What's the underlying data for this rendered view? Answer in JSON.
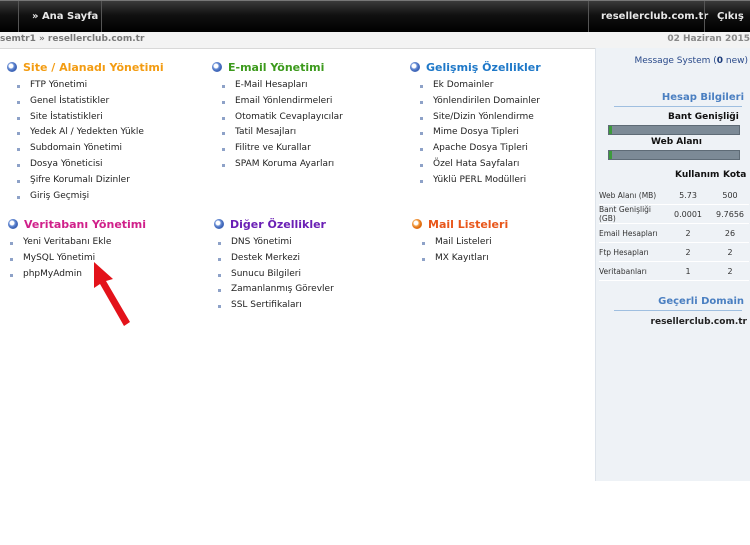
{
  "topbar": {
    "home_label": "» Ana Sayfa",
    "domain_label": "resellerclub.com.tr",
    "logout_label": "Çıkış"
  },
  "breadcrumb": {
    "text": "semtr1 » resellerclub.com.tr",
    "date": "02 Haziran 2015"
  },
  "sections": {
    "site": {
      "title": "Site / Alanadı Yönetimi",
      "color": "#f39c12",
      "items": [
        "FTP Yönetimi",
        "Genel İstatistikler",
        "Site İstatistikleri",
        "Yedek Al / Yedekten Yükle",
        "Subdomain Yönetimi",
        "Dosya Yöneticisi",
        "Şifre Korumalı Dizinler",
        "Giriş Geçmişi"
      ]
    },
    "email": {
      "title": "E-mail Yönetimi",
      "color": "#3c9a1c",
      "items": [
        "E-Mail Hesapları",
        "Email Yönlendirmeleri",
        "Otomatik Cevaplayıcılar",
        "Tatil Mesajları",
        "Filitre ve Kurallar",
        "SPAM Koruma Ayarları"
      ]
    },
    "advanced": {
      "title": "Gelişmiş Özellikler",
      "color": "#1e78c8",
      "items": [
        "Ek Domainler",
        "Yönlendirilen Domainler",
        "Site/Dizin Yönlendirme",
        "Mime Dosya Tipleri",
        "Apache Dosya Tipleri",
        "Özel Hata Sayfaları",
        "Yüklü PERL Modülleri"
      ]
    },
    "database": {
      "title": "Veritabanı Yönetimi",
      "color": "#d0208a",
      "items": [
        "Yeni Veritabanı Ekle",
        "MySQL Yönetimi",
        "phpMyAdmin"
      ]
    },
    "other": {
      "title": "Diğer Özellikler",
      "color": "#6a1fb5",
      "items": [
        "DNS Yönetimi",
        "Destek Merkezi",
        "Sunucu Bilgileri",
        "Zamanlanmış Görevler",
        "SSL Sertifikaları"
      ]
    },
    "mail_lists": {
      "title": "Mail Listeleri",
      "color": "#e8561a",
      "items": [
        "Mail Listeleri",
        "MX Kayıtları"
      ]
    }
  },
  "right_panel": {
    "message_prefix": "Message System (",
    "message_count": "0",
    "message_suffix": " new)",
    "account_title": "Hesap Bilgileri",
    "bandwidth_label": "Bant Genişliği",
    "bandwidth_usage": 0.01,
    "webspace_label": "Web Alanı",
    "webspace_usage": 0.01,
    "col_used": "Kullanım",
    "col_quota": "Kota",
    "rows": [
      {
        "label": "Web Alanı (MB)",
        "used": "5.73",
        "quota": "500"
      },
      {
        "label": "Bant Genişliği (GB)",
        "used": "0.0001",
        "quota": "9.7656"
      },
      {
        "label": "Email Hesapları",
        "used": "2",
        "quota": "26"
      },
      {
        "label": "Ftp Hesapları",
        "used": "2",
        "quota": "2"
      },
      {
        "label": "Veritabanları",
        "used": "1",
        "quota": "2"
      }
    ],
    "domain_title": "Geçerli Domain",
    "domain_value": "resellerclub.com.tr"
  }
}
